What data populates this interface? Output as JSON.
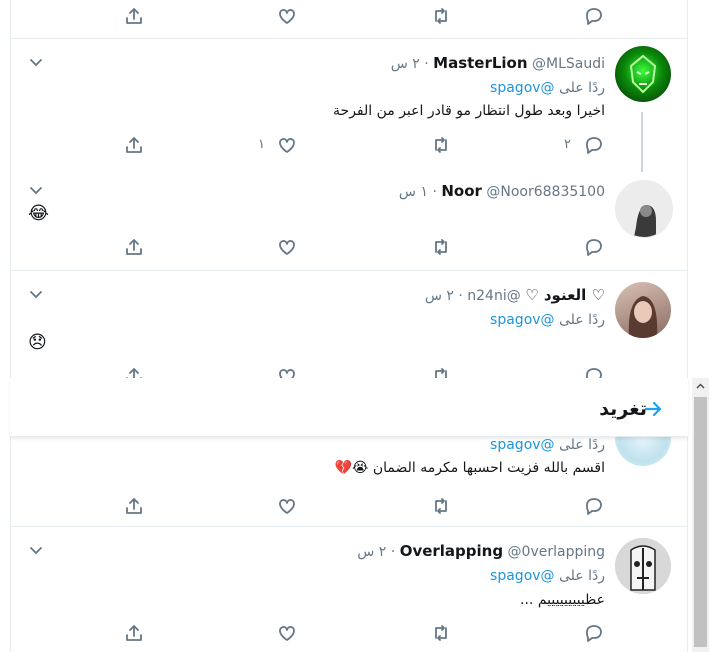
{
  "tweets": [
    {
      "name": "MasterLion",
      "handle": "@MLSaudi",
      "time": "٢ س",
      "reply_prefix": "ردًا على",
      "reply_handle": "@spagov",
      "text": "اخيرا وبعد طول انتظار مو قادر اعبر من الفرحة",
      "retweets": "٢",
      "likes": "١"
    },
    {
      "name": "Noor",
      "handle": "@Noor68835100",
      "time": "١ س",
      "emoji": "😂"
    },
    {
      "name": "♡ العنود ♡",
      "handle": "@n24ni",
      "time": "٢ س",
      "reply_prefix": "ردًا على",
      "reply_handle": "@spagov",
      "emoji": "😞"
    },
    {
      "reply_prefix": "ردًا على",
      "reply_handle": "@spagov",
      "text": "اقسم بالله فزيت احسبها مكرمه الضمان 😭💔"
    },
    {
      "name": "Overlapping",
      "handle": "@0verlapping",
      "time": "٢ س",
      "reply_prefix": "ردًا على",
      "reply_handle": "@spagov",
      "text": "عظيييييييييم ..."
    }
  ],
  "overlay": {
    "title": "تغريد"
  },
  "colors": {
    "link": "#1b95e0",
    "secondary": "#657786",
    "border": "#e6ecf0",
    "accent": "#1da1f2"
  },
  "icons": [
    "share-icon",
    "like-icon",
    "retweet-icon",
    "reply-icon",
    "chevron-down-icon",
    "back-arrow-icon"
  ]
}
